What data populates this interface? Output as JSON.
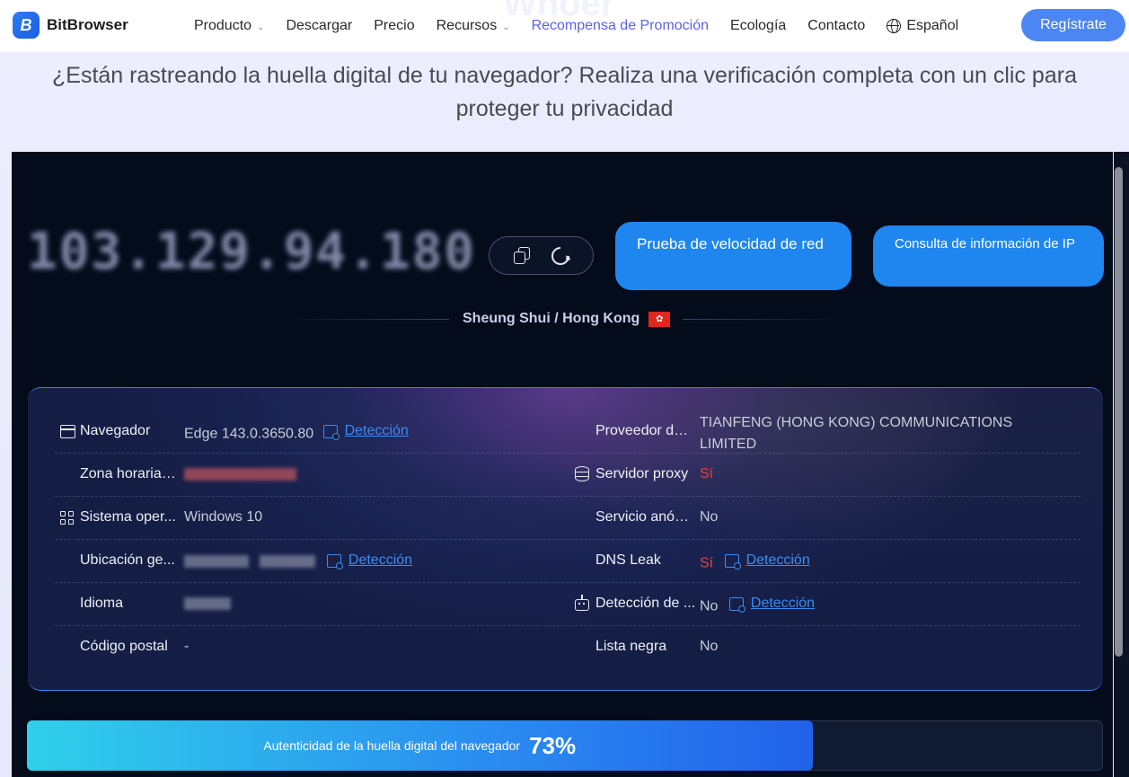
{
  "brand": {
    "name": "BitBrowser",
    "logo_letter": "B"
  },
  "watermark": "Whoer",
  "nav": {
    "items": [
      {
        "label": "Producto",
        "has_dropdown": true
      },
      {
        "label": "Descargar",
        "has_dropdown": false
      },
      {
        "label": "Precio",
        "has_dropdown": false
      },
      {
        "label": "Recursos",
        "has_dropdown": true
      },
      {
        "label": "Recompensa de Promoción",
        "has_dropdown": false
      },
      {
        "label": "Ecología",
        "has_dropdown": false
      },
      {
        "label": "Contacto",
        "has_dropdown": false
      }
    ],
    "language": "Español",
    "signup": "Regístrate"
  },
  "headline": "¿Están rastreando la huella digital de tu navegador? Realiza una verificación completa con un clic para proteger tu privacidad",
  "ip": {
    "address": "103.129.94.180",
    "speed_test_button": "Prueba de velocidad de red",
    "ip_info_button": "Consulta de información de IP",
    "location": "Sheung Shui / Hong Kong",
    "flag": "HK"
  },
  "info": {
    "detect_label": "Detección",
    "left": [
      {
        "icon": "browser-icon",
        "label": "Navegador",
        "value": "Edge 143.0.3650.80",
        "detect": true
      },
      {
        "icon": "",
        "label": "Zona horaria ...",
        "value": "",
        "blurred": true,
        "detect": false
      },
      {
        "icon": "grid-icon",
        "label": "Sistema oper...",
        "value": "Windows 10",
        "detect": false
      },
      {
        "icon": "",
        "label": "Ubicación ge...",
        "value": "",
        "blurred": true,
        "detect": true
      },
      {
        "icon": "",
        "label": "Idioma",
        "value": "",
        "blurred": true,
        "detect": false
      },
      {
        "icon": "",
        "label": "Código postal",
        "value": "-",
        "detect": false
      }
    ],
    "right": [
      {
        "icon": "",
        "label": "Proveedor de...",
        "value": "TIANFENG (HONG KONG) COMMUNICATIONS LIMITED",
        "detect": false
      },
      {
        "icon": "database-icon",
        "label": "Servidor proxy",
        "value": "Sí",
        "alert": true,
        "detect": false
      },
      {
        "icon": "",
        "label": "Servicio anón...",
        "value": "No",
        "detect": false
      },
      {
        "icon": "",
        "label": "DNS Leak",
        "value": "Sí",
        "alert": true,
        "detect": true
      },
      {
        "icon": "robot-icon",
        "label": "Detección de ...",
        "value": "No",
        "detect": true
      },
      {
        "icon": "",
        "label": "Lista negra",
        "value": "No",
        "detect": false
      }
    ]
  },
  "authenticity": {
    "label": "Autenticidad de la huella digital del navegador",
    "percent_text": "73%",
    "percent": 73
  }
}
